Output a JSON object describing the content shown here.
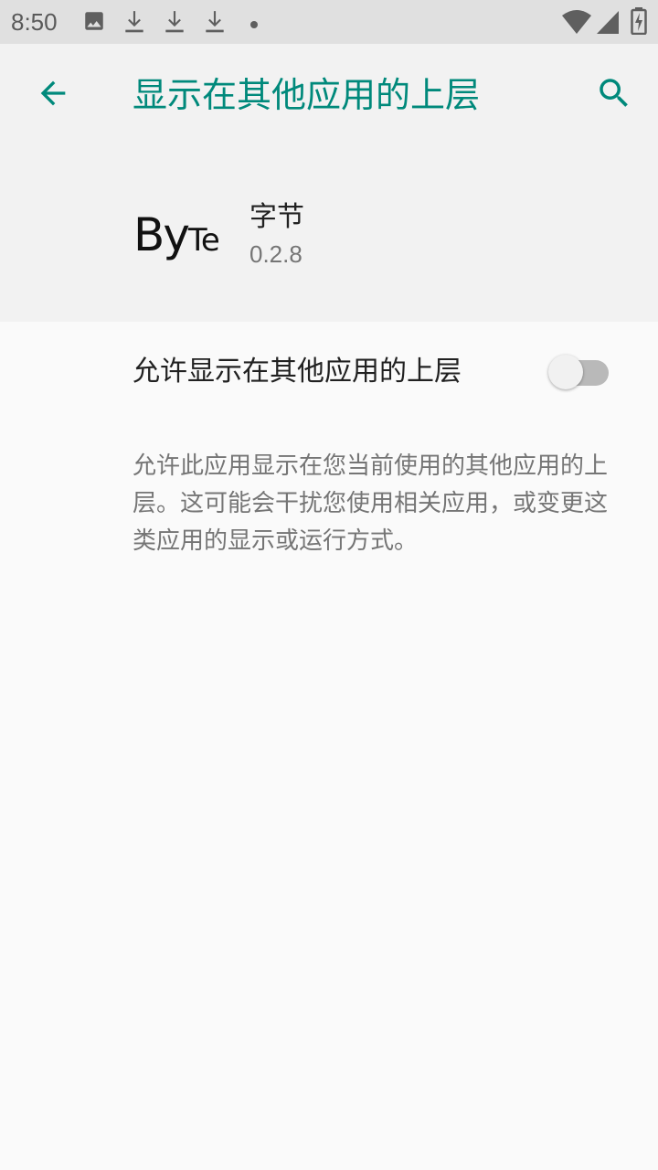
{
  "status_bar": {
    "time": "8:50",
    "notification_icons": [
      "image-icon",
      "download-icon",
      "download-icon",
      "download-icon",
      "dot-icon"
    ],
    "system_icons": [
      "wifi-icon",
      "cell-signal-icon",
      "battery-charging-icon"
    ]
  },
  "app_bar": {
    "title": "显示在其他应用的上层",
    "back_icon": "arrow-back-icon",
    "search_icon": "search-icon",
    "accent_color": "#00897b"
  },
  "app_info": {
    "logo_big_1": "B",
    "logo_big_2": "y",
    "logo_small_1": "T",
    "logo_small_2": "e",
    "name": "字节",
    "version": "0.2.8"
  },
  "setting": {
    "toggle_label": "允许显示在其他应用的上层",
    "toggle_on": false,
    "description": "允许此应用显示在您当前使用的其他应用的上层。这可能会干扰您使用相关应用，或变更这类应用的显示或运行方式。"
  }
}
